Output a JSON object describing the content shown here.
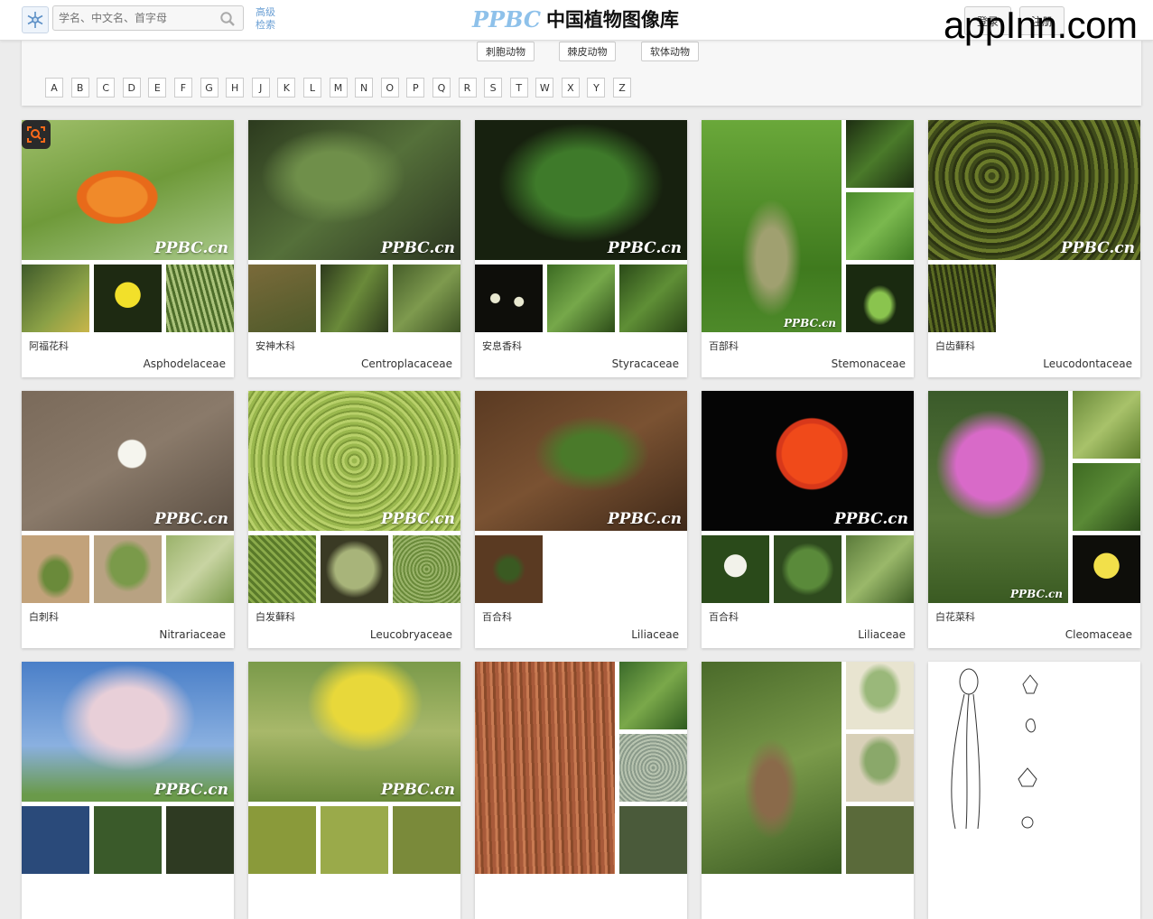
{
  "header": {
    "search_placeholder": "学名、中文名、首字母",
    "advanced_search": "高级检索",
    "brand_en": "PPBC",
    "brand_cn": "中国植物图像库",
    "login": "登录",
    "register": "注册",
    "watermark": "appInn.com"
  },
  "filter": {
    "categories": [
      "刺胞动物",
      "棘皮动物",
      "软体动物"
    ],
    "letters": [
      "A",
      "B",
      "C",
      "D",
      "E",
      "F",
      "G",
      "H",
      "J",
      "K",
      "L",
      "M",
      "N",
      "O",
      "P",
      "Q",
      "R",
      "S",
      "T",
      "W",
      "X",
      "Y",
      "Z"
    ]
  },
  "image_watermark": "PPBC.cn",
  "cards": [
    {
      "cn": "阿福花科",
      "latin": "Asphodelaceae"
    },
    {
      "cn": "安神木科",
      "latin": "Centroplacaceae"
    },
    {
      "cn": "安息香科",
      "latin": "Styracaceae"
    },
    {
      "cn": "百部科",
      "latin": "Stemonaceae"
    },
    {
      "cn": "白齿藓科",
      "latin": "Leucodontaceae"
    },
    {
      "cn": "白刺科",
      "latin": "Nitrariaceae"
    },
    {
      "cn": "白发藓科",
      "latin": "Leucobryaceae"
    },
    {
      "cn": "百合科",
      "latin": "Liliaceae"
    },
    {
      "cn": "百合科",
      "latin": "Liliaceae"
    },
    {
      "cn": "白花菜科",
      "latin": "Cleomaceae"
    },
    {
      "cn": "",
      "latin": ""
    },
    {
      "cn": "",
      "latin": ""
    },
    {
      "cn": "",
      "latin": ""
    },
    {
      "cn": "",
      "latin": ""
    },
    {
      "cn": "",
      "latin": ""
    }
  ]
}
